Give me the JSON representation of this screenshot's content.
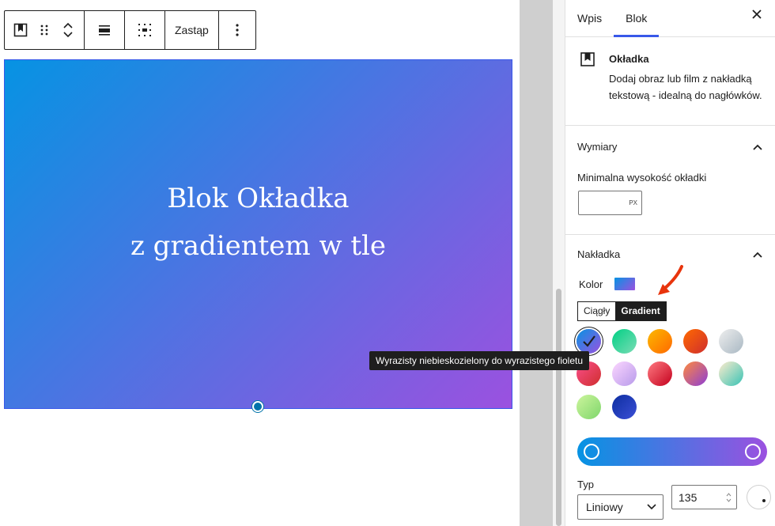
{
  "toolbar": {
    "replace_label": "Zastąp",
    "icons": [
      "cover-block-icon",
      "drag-handle-icon",
      "move-up-icon",
      "move-down-icon",
      "align-icon",
      "full-height-icon",
      "more-options-icon"
    ]
  },
  "cover": {
    "line1": "Blok Okładka",
    "line2": "z gradientem w tle",
    "gradient_start": "#0693e3",
    "gradient_end": "#9b51e0"
  },
  "sidebar": {
    "tabs": [
      {
        "label": "Wpis",
        "active": false
      },
      {
        "label": "Blok",
        "active": true
      }
    ],
    "close_icon": "close-icon",
    "block": {
      "title": "Okładka",
      "description": "Dodaj obraz lub film z nakładką tekstową - idealną do nagłówków."
    },
    "dimensions": {
      "title": "Wymiary",
      "min_height_label": "Minimalna wysokość okładki",
      "min_height_value": "",
      "unit": "PX"
    },
    "overlay": {
      "title": "Nakładka",
      "color_label": "Kolor",
      "toggle": [
        {
          "label": "Ciągły",
          "active": false
        },
        {
          "label": "Gradient",
          "active": true
        }
      ],
      "swatches": [
        {
          "color": "linear-gradient(135deg,#0693e3,#9b51e0)",
          "selected": true
        },
        {
          "color": "linear-gradient(135deg,#00d084,#7bdcb5)",
          "selected": false
        },
        {
          "color": "linear-gradient(135deg,#fcb900,#ff6900)",
          "selected": false
        },
        {
          "color": "linear-gradient(135deg,#ff6900,#cf2e2e)",
          "selected": false
        },
        {
          "color": "linear-gradient(135deg,#eeeeee,#a9b8c3)",
          "selected": false
        },
        {
          "color": "linear-gradient(135deg,#fa4f8a,#cf2e2e)",
          "selected": false
        },
        {
          "color": "linear-gradient(135deg,#fcd6ff,#b79aea)",
          "selected": false
        },
        {
          "color": "linear-gradient(135deg,#ff7b82,#c4001d)",
          "selected": false
        },
        {
          "color": "linear-gradient(135deg,#ff8a3d,#8d3dd6)",
          "selected": false
        },
        {
          "color": "linear-gradient(135deg,#ffeccd,#37c3b5)",
          "selected": false
        },
        {
          "color": "linear-gradient(135deg,#cdf59d,#7ed66b)",
          "selected": false
        },
        {
          "color": "linear-gradient(135deg,#0d2ea0,#3b4fd6)",
          "selected": false
        }
      ],
      "type_label": "Typ",
      "type_value": "Liniowy",
      "angle_value": "135"
    },
    "tooltip": "Wyrazisty niebieskozielony do wyrazistego fioletu"
  }
}
